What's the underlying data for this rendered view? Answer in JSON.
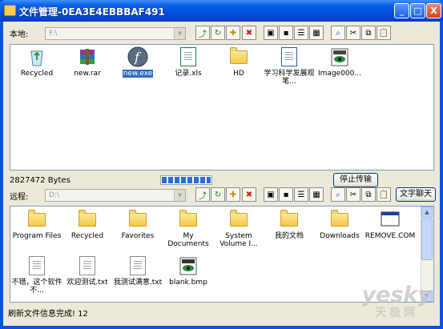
{
  "window": {
    "title": "文件管理-0EA3E4EBBBAF491",
    "minimize_glyph": "_",
    "maximize_glyph": "□",
    "close_glyph": "X"
  },
  "local": {
    "label": "本地:",
    "path": "F:\\",
    "files": [
      {
        "name": "Recycled",
        "icon": "recycle-bin-icon"
      },
      {
        "name": "new.rar",
        "icon": "rar-archive-icon"
      },
      {
        "name": "new.exe",
        "icon": "flash-exe-icon",
        "selected": true
      },
      {
        "name": "记录.xls",
        "icon": "excel-file-icon"
      },
      {
        "name": "HD",
        "icon": "folder-icon"
      },
      {
        "name": "学习科学发展观笔...",
        "icon": "word-file-icon"
      },
      {
        "name": "Image000...",
        "icon": "image-file-icon"
      }
    ],
    "bytes_status": "2827472 Bytes",
    "stop_transfer_label": "停止传输"
  },
  "remote": {
    "label": "远程:",
    "path": "D:\\",
    "chat_label": "文字聊天",
    "files": [
      {
        "name": "Program Files",
        "icon": "folder-icon"
      },
      {
        "name": "Recycled",
        "icon": "folder-icon"
      },
      {
        "name": "Favorites",
        "icon": "folder-icon"
      },
      {
        "name": "My Documents",
        "icon": "folder-icon"
      },
      {
        "name": "System Volume I...",
        "icon": "folder-icon"
      },
      {
        "name": "我的文档",
        "icon": "folder-icon"
      },
      {
        "name": "Downloads",
        "icon": "folder-icon"
      },
      {
        "name": "REMOVE.COM",
        "icon": "window-file-icon"
      },
      {
        "name": "不错，这个软件不...",
        "icon": "text-file-icon"
      },
      {
        "name": "欢迎测试.txt",
        "icon": "text-file-icon"
      },
      {
        "name": "我测试满意.txt",
        "icon": "text-file-icon"
      },
      {
        "name": "blank.bmp",
        "icon": "bitmap-file-icon"
      }
    ]
  },
  "toolbar_icons": [
    "up-folder-icon",
    "refresh-icon",
    "new-folder-icon",
    "delete-icon",
    "large-icons-view-icon",
    "small-icons-view-icon",
    "list-view-icon",
    "details-view-icon",
    "find-icon",
    "cut-icon",
    "copy-icon",
    "paste-icon"
  ],
  "progress": {
    "fraction": 1.0
  },
  "status_bar": "刷新文件信息完成! 12",
  "watermark": {
    "brand": "yesky",
    "sub": "天极网"
  },
  "colors": {
    "titlebar": "#0a54e3",
    "selection": "#316ac5",
    "progress": "#2a6fd8"
  }
}
